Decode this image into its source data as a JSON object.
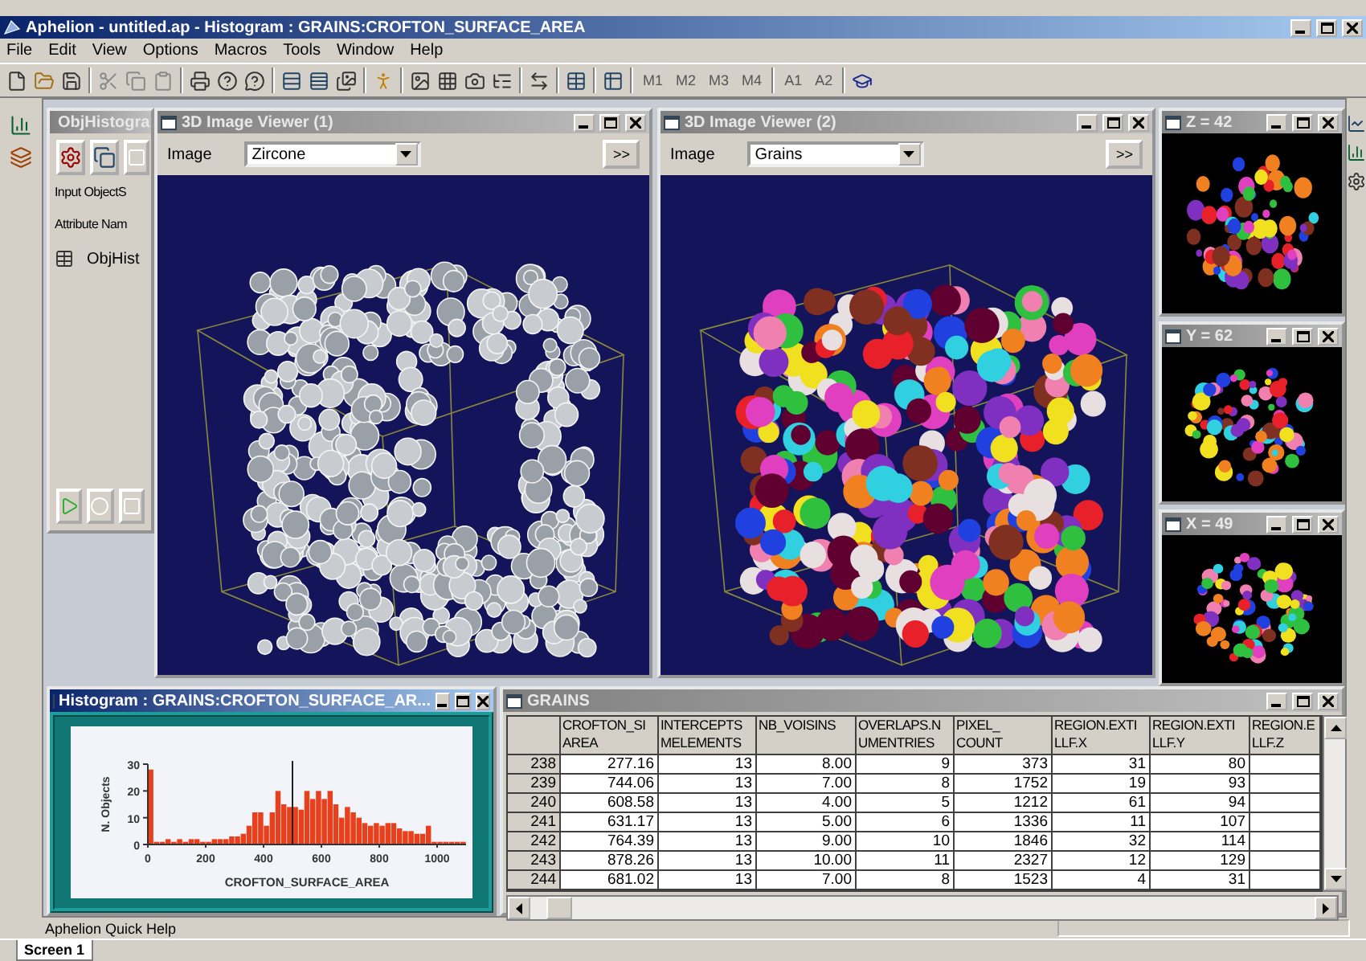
{
  "app": {
    "title": "Aphelion - untitled.ap - Histogram : GRAINS:CROFTON_SURFACE_AREA"
  },
  "menu": [
    "File",
    "Edit",
    "View",
    "Options",
    "Macros",
    "Tools",
    "Window",
    "Help"
  ],
  "toolbar": {
    "text_buttons": [
      "M1",
      "M2",
      "M3",
      "M4",
      "A1",
      "A2"
    ]
  },
  "obj_panel": {
    "title": "ObjHistogra",
    "active": false,
    "labels": [
      "Input ObjectS",
      "Attribute Nam"
    ],
    "item": "ObjHist"
  },
  "viewers": [
    {
      "title": "3D Image Viewer (1)",
      "active": false,
      "image_label": "Image",
      "image_value": "Zircone",
      "expand": ">>",
      "kind": "grey"
    },
    {
      "title": "3D Image Viewer (2)",
      "active": false,
      "image_label": "Image",
      "image_value": "Grains",
      "expand": ">>",
      "kind": "color"
    }
  ],
  "slices": [
    {
      "title": "Z = 42",
      "active": false
    },
    {
      "title": "Y = 62",
      "active": false
    },
    {
      "title": "X = 49",
      "active": false
    }
  ],
  "histogram": {
    "title": "Histogram : GRAINS:CROFTON_SURFACE_AR...",
    "active": true,
    "chart_data": {
      "type": "bar",
      "xlabel": "CROFTON_SURFACE_AREA",
      "ylabel": "N. Objects",
      "x": [
        10,
        30,
        50,
        70,
        90,
        110,
        130,
        150,
        170,
        190,
        210,
        230,
        250,
        270,
        290,
        310,
        330,
        350,
        370,
        390,
        410,
        430,
        450,
        470,
        490,
        510,
        530,
        550,
        570,
        590,
        610,
        630,
        650,
        670,
        690,
        710,
        730,
        750,
        770,
        790,
        810,
        830,
        850,
        870,
        890,
        910,
        930,
        950,
        970,
        990,
        1010,
        1030,
        1050,
        1070,
        1090
      ],
      "values": [
        28,
        1,
        1,
        2,
        1,
        2,
        1,
        2,
        2,
        1,
        1,
        2,
        2,
        2,
        3,
        3,
        4,
        7,
        12,
        12,
        7,
        12,
        20,
        15,
        14,
        14,
        13,
        20,
        17,
        20,
        17,
        20,
        15,
        10,
        14,
        12,
        10,
        8,
        7,
        8,
        7,
        8,
        8,
        6,
        5,
        5,
        4,
        4,
        7,
        1,
        1,
        1,
        1,
        1,
        1
      ],
      "xlim": [
        0,
        1100
      ],
      "ylim": [
        0,
        30
      ],
      "xticks": [
        0,
        200,
        400,
        600,
        800,
        1000
      ],
      "yticks": [
        0,
        10,
        20,
        30
      ],
      "ref_lines": [
        {
          "axis": "x",
          "value": 500
        }
      ]
    }
  },
  "table": {
    "title": "GRAINS",
    "active": false,
    "columns": [
      "CROFTON_SI\nAREA",
      "INTERCEPTS\nMELEMENTS",
      "NB_VOISINS",
      "OVERLAPS.N\nUMENTRIES",
      "PIXEL_\nCOUNT",
      "REGION.EXTI\nLLF.X",
      "REGION.EXTI\nLLF.Y",
      "REGION.E\nLLF.Z"
    ],
    "rows": [
      {
        "label": "238",
        "cells": [
          "277.16",
          "13",
          "8.00",
          "9",
          "373",
          "31",
          "80"
        ]
      },
      {
        "label": "239",
        "cells": [
          "744.06",
          "13",
          "7.00",
          "8",
          "1752",
          "19",
          "93"
        ]
      },
      {
        "label": "240",
        "cells": [
          "608.58",
          "13",
          "4.00",
          "5",
          "1212",
          "61",
          "94"
        ]
      },
      {
        "label": "241",
        "cells": [
          "631.17",
          "13",
          "5.00",
          "6",
          "1336",
          "11",
          "107"
        ]
      },
      {
        "label": "242",
        "cells": [
          "764.39",
          "13",
          "9.00",
          "10",
          "1846",
          "32",
          "114"
        ]
      },
      {
        "label": "243",
        "cells": [
          "878.26",
          "13",
          "10.00",
          "11",
          "2327",
          "12",
          "129"
        ]
      },
      {
        "label": "244",
        "cells": [
          "681.02",
          "13",
          "7.00",
          "8",
          "1523",
          "4",
          "31"
        ]
      }
    ]
  },
  "status": {
    "help": "Aphelion Quick Help",
    "tabs": [
      {
        "label": "Screen 1",
        "selected": true
      }
    ]
  }
}
